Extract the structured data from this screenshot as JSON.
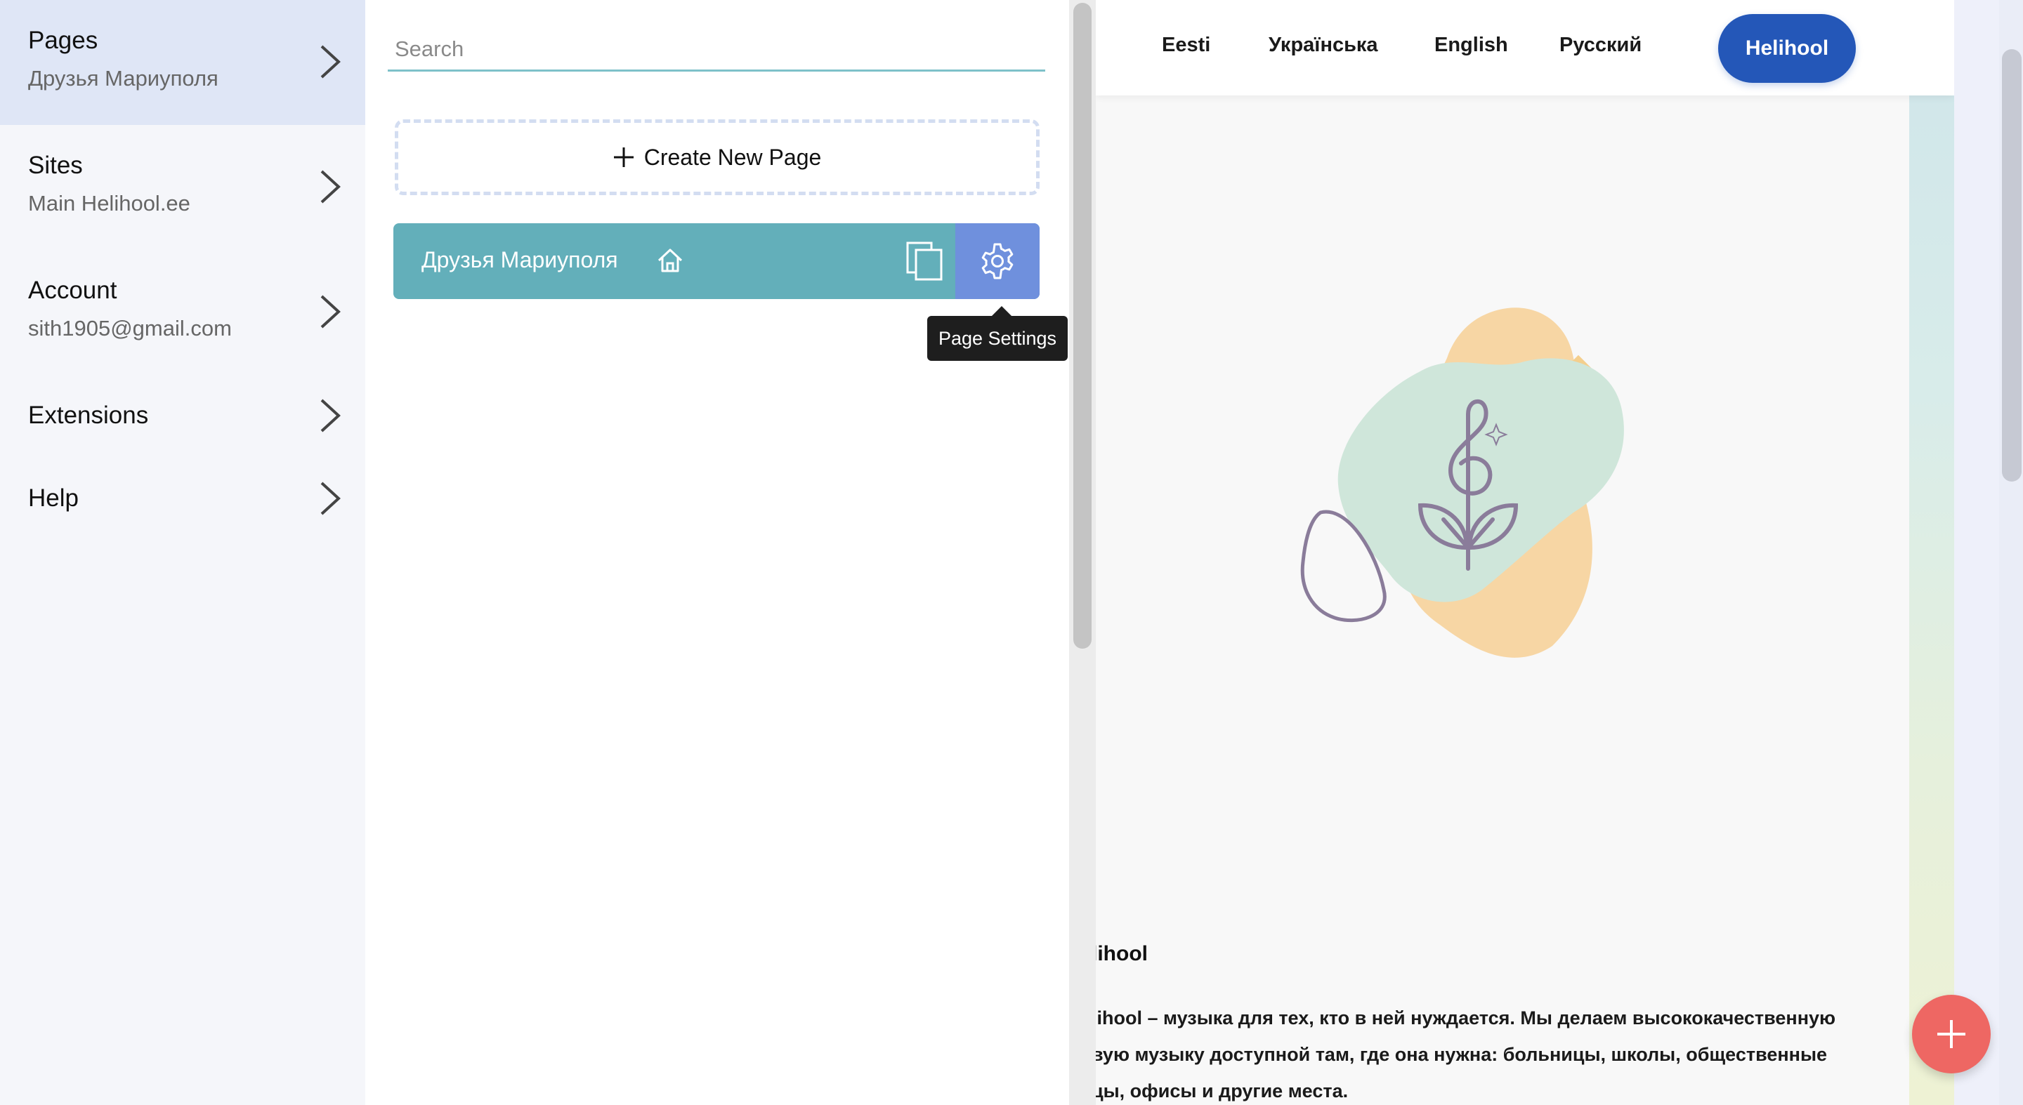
{
  "nav": {
    "pages": {
      "title": "Pages",
      "sub": "Друзья Мариуполя"
    },
    "sites": {
      "title": "Sites",
      "sub": "Main Helihool.ee"
    },
    "account": {
      "title": "Account",
      "sub": "sith1905@gmail.com"
    },
    "extensions": {
      "title": "Extensions"
    },
    "help": {
      "title": "Help"
    },
    "chevron_icon": "chevron-right-icon"
  },
  "pages_panel": {
    "search_placeholder": "Search",
    "create_label": "Create New Page",
    "page_rows": [
      {
        "name": "Друзья Мариуполя",
        "is_home": true
      }
    ],
    "tooltip": "Page Settings",
    "row_color": "#63afba",
    "settings_color": "#6f90dd"
  },
  "preview": {
    "languages": [
      "Eesti",
      "Українська",
      "English",
      "Русский"
    ],
    "brand_button": "Helihool",
    "brand_color": "#2457b8",
    "section_title": "lihool",
    "text_lines": [
      "lihool – музыка для тех, кто в ней нуждается. Мы делаем высококачественную",
      "вую музыку доступной там, где она нужна: больницы, школы, общественные",
      "цы, офисы и другие места."
    ],
    "fab_color": "#ee6763"
  }
}
